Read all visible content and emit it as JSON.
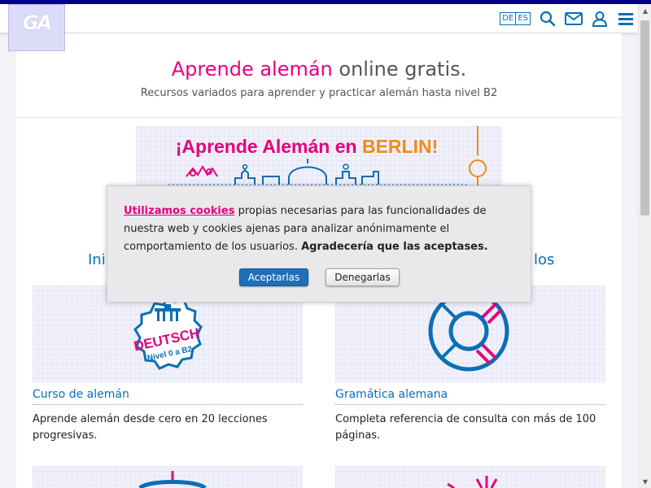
{
  "header": {
    "logo_text": "GA",
    "lang_de": "DE",
    "lang_es": "ES",
    "icons": [
      "search-icon",
      "mail-icon",
      "user-icon",
      "menu-icon"
    ]
  },
  "hero": {
    "title_accent": "Aprende alemán",
    "title_rest": " online gratis.",
    "subtitle": "Recursos variados para aprender y practicar alemán hasta nivel B2"
  },
  "banner": {
    "text_main": "¡Aprende Alemán en ",
    "text_city": "BERLIN!"
  },
  "section": {
    "left_fragment": "Ini",
    "right_fragment": "los"
  },
  "cards": [
    {
      "badge_line1": "DEUTSCH",
      "badge_line2": "Nivel 0 a B2",
      "title": "Curso de alemán",
      "desc": "Aprende alemán desde cero en 20 lecciones progresivas."
    },
    {
      "title": "Gramática alemana",
      "desc": "Completa referencia de consulta con más de 100 páginas."
    }
  ],
  "cookie": {
    "link": "Utilizamos cookies",
    "text": " propias necesarias para las funcionalidades de nuestra web y cookies ajenas para analizar anónimamente el comportamiento de los usuarios. ",
    "strong": "Agradecería que las aceptases.",
    "accept": "Aceptarlas",
    "deny": "Denegarlas"
  },
  "colors": {
    "accent_pink": "#e6007e",
    "accent_blue": "#0a6fb5",
    "accent_orange": "#f08a1c",
    "topbar": "#00008b"
  }
}
